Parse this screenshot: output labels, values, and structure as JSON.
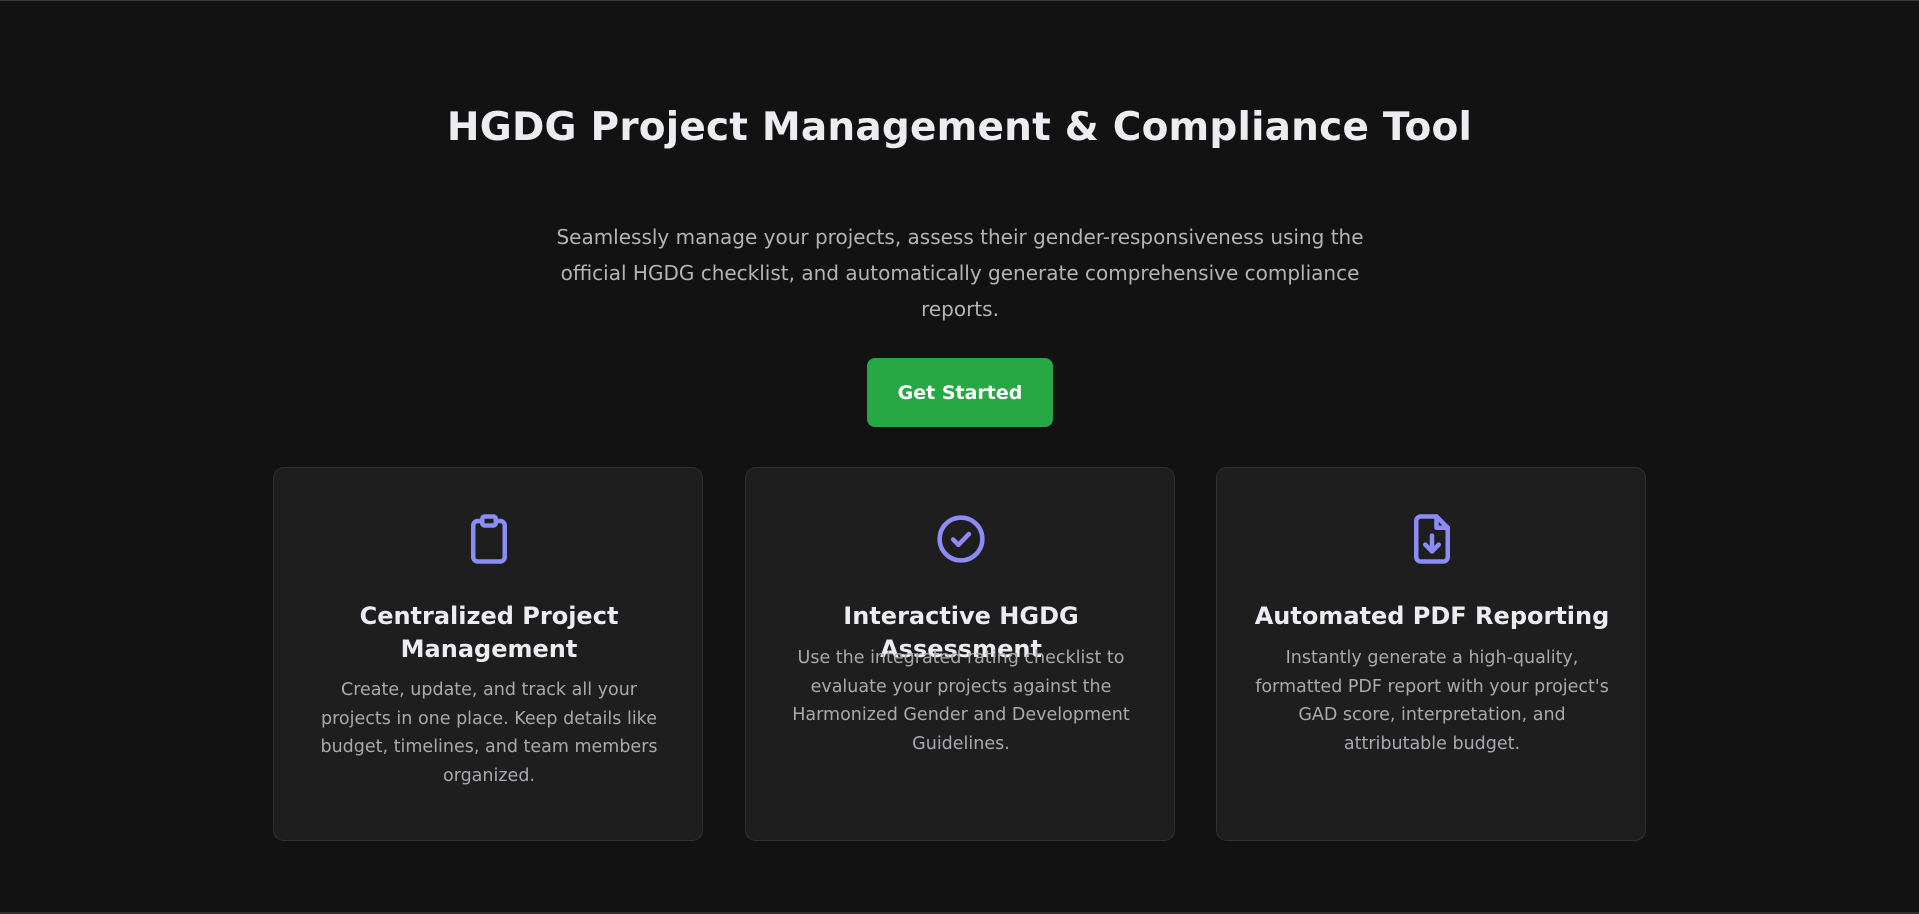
{
  "hero": {
    "title": "HGDG Project Management & Compliance Tool",
    "subtitle": "Seamlessly manage your projects, assess their gender-responsiveness using the official HGDG checklist, and automatically generate comprehensive compliance reports.",
    "cta_label": "Get Started"
  },
  "features": [
    {
      "icon": "clipboard-icon",
      "title": "Centralized Project Management",
      "description": "Create, update, and track all your projects in one place. Keep details like budget, timelines, and team members organized."
    },
    {
      "icon": "check-circle-icon",
      "title": "Interactive HGDG Assessment",
      "description": "Use the integrated rating checklist to evaluate your projects against the Harmonized Gender and Development Guidelines."
    },
    {
      "icon": "file-download-icon",
      "title": "Automated PDF Reporting",
      "description": "Instantly generate a high-quality, formatted PDF report with your project's GAD score, interpretation, and attributable budget."
    }
  ],
  "colors": {
    "background": "#121212",
    "card_background": "#1e1e1f",
    "accent_button": "#28a745",
    "icon_color": "#8b8cf6",
    "heading_text": "#ececf1",
    "body_text": "#a9a9ae"
  }
}
